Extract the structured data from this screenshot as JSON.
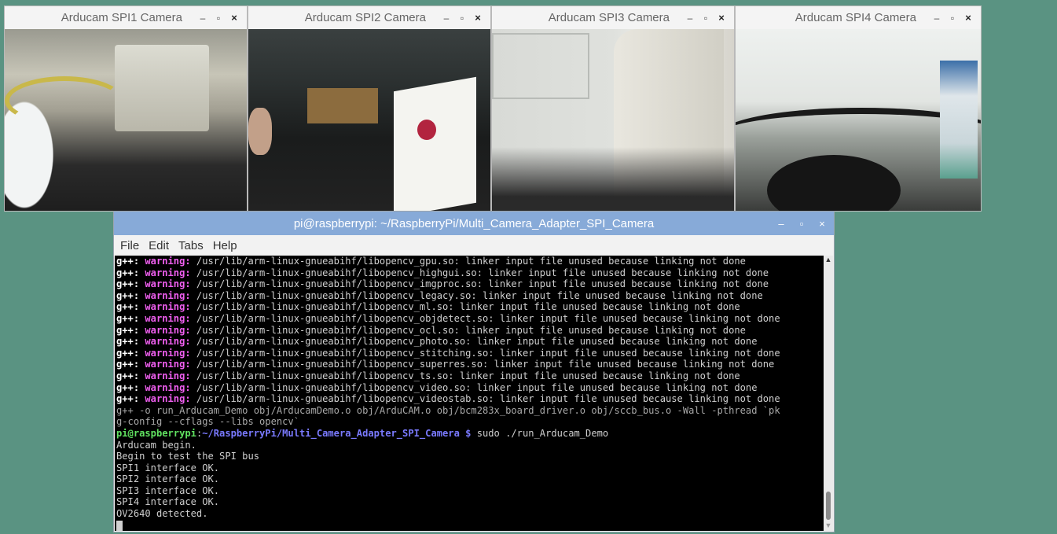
{
  "cameras": [
    {
      "title": "Arducam SPI1 Camera"
    },
    {
      "title": "Arducam SPI2 Camera"
    },
    {
      "title": "Arducam SPI3 Camera"
    },
    {
      "title": "Arducam SPI4 Camera"
    }
  ],
  "window_controls": {
    "minimize": "–",
    "maximize": "▫",
    "close": "×"
  },
  "terminal": {
    "title": "pi@raspberrypi: ~/RaspberryPi/Multi_Camera_Adapter_SPI_Camera",
    "menu": [
      "File",
      "Edit",
      "Tabs",
      "Help"
    ],
    "warnings": [
      {
        "prefix": "g++:",
        "label": "warning:",
        "text": " /usr/lib/arm-linux-gnueabihf/libopencv_gpu.so: linker input file unused because linking not done"
      },
      {
        "prefix": "g++:",
        "label": "warning:",
        "text": " /usr/lib/arm-linux-gnueabihf/libopencv_highgui.so: linker input file unused because linking not done"
      },
      {
        "prefix": "g++:",
        "label": "warning:",
        "text": " /usr/lib/arm-linux-gnueabihf/libopencv_imgproc.so: linker input file unused because linking not done"
      },
      {
        "prefix": "g++:",
        "label": "warning:",
        "text": " /usr/lib/arm-linux-gnueabihf/libopencv_legacy.so: linker input file unused because linking not done"
      },
      {
        "prefix": "g++:",
        "label": "warning:",
        "text": " /usr/lib/arm-linux-gnueabihf/libopencv_ml.so: linker input file unused because linking not done"
      },
      {
        "prefix": "g++:",
        "label": "warning:",
        "text": " /usr/lib/arm-linux-gnueabihf/libopencv_objdetect.so: linker input file unused because linking not done"
      },
      {
        "prefix": "g++:",
        "label": "warning:",
        "text": " /usr/lib/arm-linux-gnueabihf/libopencv_ocl.so: linker input file unused because linking not done"
      },
      {
        "prefix": "g++:",
        "label": "warning:",
        "text": " /usr/lib/arm-linux-gnueabihf/libopencv_photo.so: linker input file unused because linking not done"
      },
      {
        "prefix": "g++:",
        "label": "warning:",
        "text": " /usr/lib/arm-linux-gnueabihf/libopencv_stitching.so: linker input file unused because linking not done"
      },
      {
        "prefix": "g++:",
        "label": "warning:",
        "text": " /usr/lib/arm-linux-gnueabihf/libopencv_superres.so: linker input file unused because linking not done"
      },
      {
        "prefix": "g++:",
        "label": "warning:",
        "text": " /usr/lib/arm-linux-gnueabihf/libopencv_ts.so: linker input file unused because linking not done"
      },
      {
        "prefix": "g++:",
        "label": "warning:",
        "text": " /usr/lib/arm-linux-gnueabihf/libopencv_video.so: linker input file unused because linking not done"
      },
      {
        "prefix": "g++:",
        "label": "warning:",
        "text": " /usr/lib/arm-linux-gnueabihf/libopencv_videostab.so: linker input file unused because linking not done"
      }
    ],
    "compile_cmd": [
      "g++ -o run_Arducam_Demo obj/ArducamDemo.o obj/ArduCAM.o obj/bcm283x_board_driver.o obj/sccb_bus.o -Wall -pthread `pk",
      "g-config --cflags --libs opencv`"
    ],
    "prompt": {
      "user": "pi@raspberrypi",
      "sep": ":",
      "path": "~/RaspberryPi/Multi_Camera_Adapter_SPI_Camera",
      "sym": " $ ",
      "command": "sudo ./run_Arducam_Demo"
    },
    "output": [
      "Arducam begin.",
      "Begin to test the SPI bus",
      "SPI1 interface OK.",
      "SPI2 interface OK.",
      "SPI3 interface OK.",
      "SPI4 interface OK.",
      "OV2640 detected."
    ],
    "scroll_up": "▲",
    "scroll_down": "▼"
  }
}
